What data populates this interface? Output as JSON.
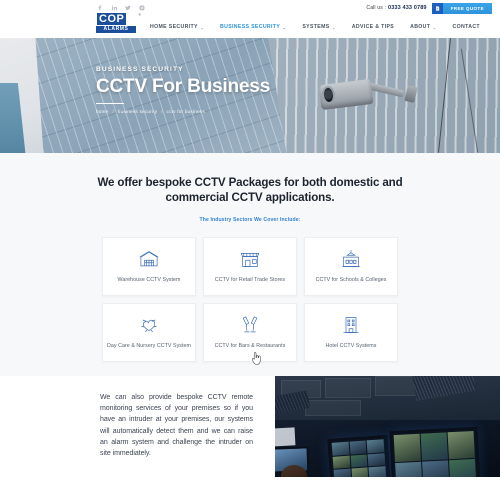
{
  "topbar": {
    "social": [
      {
        "name": "facebook-icon",
        "glyph": "f"
      },
      {
        "name": "linkedin-icon",
        "glyph": "in"
      },
      {
        "name": "twitter-icon",
        "glyph": "t"
      },
      {
        "name": "instagram-icon",
        "glyph": "ig"
      }
    ],
    "call_label": "Call us :",
    "phone": "0333 433 0789",
    "quote_button": "FREE QUOTE"
  },
  "logo": {
    "line1": "COP",
    "line2": "ALARMS",
    "registered": "®"
  },
  "nav": {
    "items": [
      {
        "label": "HOME SECURITY",
        "has_dropdown": true,
        "active": false
      },
      {
        "label": "BUSINESS SECURITY",
        "has_dropdown": true,
        "active": true
      },
      {
        "label": "SYSTEMS",
        "has_dropdown": true,
        "active": false
      },
      {
        "label": "ADVICE & TIPS",
        "has_dropdown": false,
        "active": false
      },
      {
        "label": "ABOUT",
        "has_dropdown": true,
        "active": false
      },
      {
        "label": "CONTACT",
        "has_dropdown": false,
        "active": false
      }
    ],
    "caret": "⌄"
  },
  "hero": {
    "eyebrow": "BUSINESS SECURITY",
    "title": "CCTV For Business",
    "breadcrumbs": [
      "home",
      "business security",
      "cctv for business"
    ],
    "separator": "/"
  },
  "main": {
    "headline": "We offer bespoke CCTV Packages for both domestic and commercial CCTV applications.",
    "subhead": "The Industry Sectors We Cover Include:",
    "cards": [
      {
        "icon": "warehouse-icon",
        "label": "Warehouse\nCCTV System"
      },
      {
        "icon": "retail-store-icon",
        "label": "CCTV for Retail\nTrade Stores"
      },
      {
        "icon": "school-building-icon",
        "label": "CCTV for Schools\n& Colleges"
      },
      {
        "icon": "childcare-heart-icon",
        "label": "Day Care & Nursery\nCCTV System"
      },
      {
        "icon": "cheers-glasses-icon",
        "label": "CCTV for Bars &\nRestaurants"
      },
      {
        "icon": "hotel-building-icon",
        "label": "Hotel CCTV\nSystems"
      }
    ]
  },
  "bottom": {
    "paragraph": "We can also provide bespoke CCTV remote monitoring services of your premises so if you have an intruder at your premises, our systems will automatically detect them and we can raise an alarm system and challenge the intruder on site immediately.",
    "image_alt": "cctv-control-room-photo"
  },
  "colors": {
    "brand_blue": "#1b4f9c",
    "accent_blue": "#2f93dd",
    "link_blue": "#2f7fd0",
    "icon_blue": "#3b6cb5",
    "text_dark": "#1c2430"
  }
}
